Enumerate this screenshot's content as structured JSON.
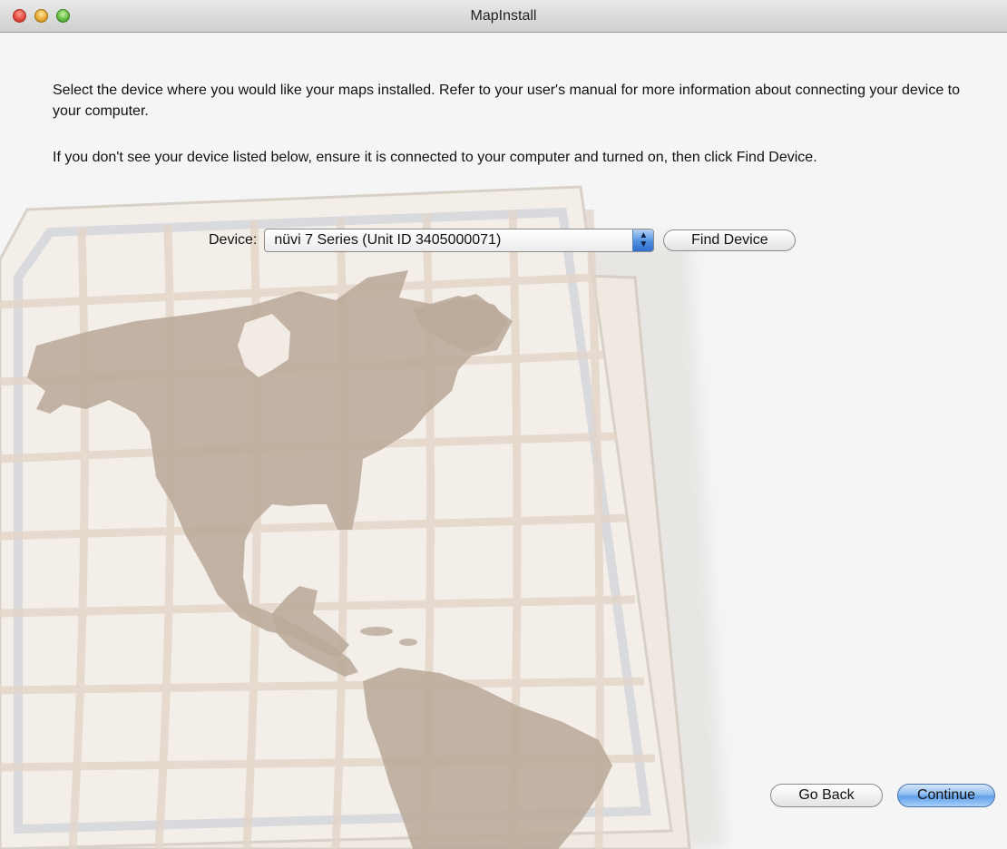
{
  "window": {
    "title": "MapInstall"
  },
  "content": {
    "instruction_1": "Select the device where you would like your maps installed. Refer to your user's manual for more information about connecting your device to your computer.",
    "instruction_2": "If you don't see your device listed below, ensure it is connected to your computer and turned on, then click Find Device."
  },
  "device": {
    "label": "Device:",
    "selected": "nüvi 7 Series (Unit ID 3405000071)",
    "find_button": "Find Device"
  },
  "footer": {
    "back_button": "Go Back",
    "continue_button": "Continue"
  },
  "icons": {
    "close": "close-button-icon",
    "minimize": "minimize-button-icon",
    "zoom": "zoom-button-icon",
    "select_arrows": "up-down-arrows-icon",
    "background": "world-map-illustration"
  },
  "colors": {
    "accent": "#5fa0ea",
    "map_land": "#b8a898",
    "map_paper": "#f2ece4"
  }
}
